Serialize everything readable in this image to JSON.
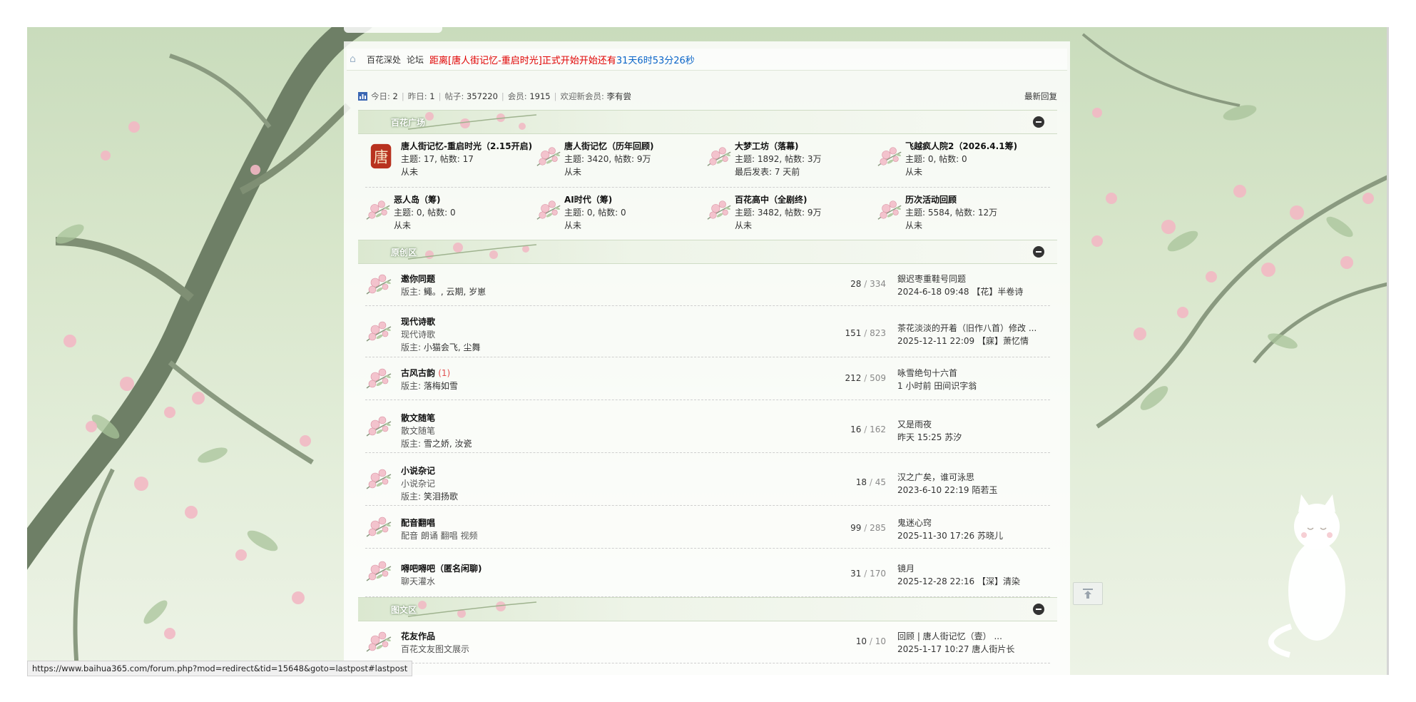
{
  "breadcrumb": {
    "crumbs": [
      "百花深处",
      "论坛"
    ],
    "notice_red_prefix": "距离[唐人街记忆-重启时光]正式开始开始还有",
    "countdown": "31天6时53分26秒"
  },
  "stats": {
    "today_label": "今日:",
    "today_value": "2",
    "yesterday_label": "昨日:",
    "yesterday_value": "1",
    "posts_label": "帖子:",
    "posts_value": "357220",
    "members_label": "会员:",
    "members_value": "1915",
    "welcome_label": "欢迎新会员:",
    "newest_member": "李有尝",
    "latest_replies": "最新回复"
  },
  "sections": {
    "plaza": {
      "title": "百花广场",
      "forums": [
        {
          "name": "唐人街记忆-重启时光（2.15开启)",
          "stats": "主题: 17, 帖数: 17",
          "last": "从未",
          "icon": "tang-seal-icon"
        },
        {
          "name": "唐人街记忆（历年回顾)",
          "stats": "主题: 3420, 帖数: 9万",
          "last": "从未",
          "icon": "flower-icon"
        },
        {
          "name": "大梦工坊（落幕)",
          "stats": "主题: 1892, 帖数: 3万",
          "last": "最后发表: 7 天前",
          "icon": "flower-icon"
        },
        {
          "name": "飞越疯人院2（2026.4.1筹)",
          "stats": "主题: 0, 帖数: 0",
          "last": "从未",
          "icon": "flower-icon"
        },
        {
          "name": "恶人岛（筹)",
          "stats": "主题: 0, 帖数: 0",
          "last": "从未",
          "icon": "flower-icon"
        },
        {
          "name": "AI时代（筹)",
          "stats": "主题: 0, 帖数: 0",
          "last": "从未",
          "icon": "flower-icon"
        },
        {
          "name": "百花高中（全剧终)",
          "stats": "主题: 3482, 帖数: 9万",
          "last": "从未",
          "icon": "flower-icon"
        },
        {
          "name": "历次活动回顾",
          "stats": "主题: 5584, 帖数: 12万",
          "last": "从未",
          "icon": "flower-icon"
        }
      ]
    },
    "original": {
      "title": "原创区",
      "forums": [
        {
          "name": "邀你同题",
          "today": "",
          "desc": "",
          "mods_label": "版主:",
          "mods": "鱦。, 云期, 岁崽",
          "threads": "28",
          "posts": "334",
          "lp_title": "銀迟枣重鞋号同题",
          "lp_meta": "2024-6-18 09:48 【花】半卷诗"
        },
        {
          "name": "现代诗歌",
          "today": "",
          "desc": "现代诗歌",
          "mods_label": "版主:",
          "mods": "小猫会飞, 尘舞",
          "threads": "151",
          "posts": "823",
          "lp_title": "茶花淡淡的开着（旧作八首）修改 ...",
          "lp_meta": "2025-12-11 22:09 【寐】萧忆情"
        },
        {
          "name": "古风古韵",
          "today": "(1)",
          "desc": "",
          "mods_label": "版主:",
          "mods": "落梅如雪",
          "threads": "212",
          "posts": "509",
          "lp_title": "咏雪绝句十六首",
          "lp_meta": "1 小时前 田间识字翁"
        },
        {
          "name": "散文随笔",
          "today": "",
          "desc": "散文随笔",
          "mods_label": "版主:",
          "mods": "雪之娇, 汝瓷",
          "threads": "16",
          "posts": "162",
          "lp_title": "又是雨夜",
          "lp_meta": "昨天 15:25 苏汐"
        },
        {
          "name": "小说杂记",
          "today": "",
          "desc": "小说杂记",
          "mods_label": "版主:",
          "mods": "笑泪扬歌",
          "threads": "18",
          "posts": "45",
          "lp_title": "汉之广矣，谁可泳思",
          "lp_meta": "2023-6-10 22:19 陌若玉"
        },
        {
          "name": "配音翻唱",
          "today": "",
          "desc": "配音 朗诵 翻唱 视频",
          "mods_label": "",
          "mods": "",
          "threads": "99",
          "posts": "285",
          "lp_title": "鬼迷心窍",
          "lp_meta": "2025-11-30 17:26 苏晓儿"
        },
        {
          "name": "嘚吧嘚吧（匿名闲聊)",
          "today": "",
          "desc": "聊天灌水",
          "mods_label": "",
          "mods": "",
          "threads": "31",
          "posts": "170",
          "lp_title": "镜月",
          "lp_meta": "2025-12-28 22:16 【深】清染"
        }
      ]
    },
    "graphic": {
      "title": "图文区",
      "forums": [
        {
          "name": "花友作品",
          "today": "",
          "desc": "百花文友图文展示",
          "mods_label": "",
          "mods": "",
          "threads": "10",
          "posts": "10",
          "lp_title": "回顾 | 唐人街记忆（壹） ...",
          "lp_meta": "2025-1-17 10:27 唐人街片长"
        }
      ]
    }
  },
  "status_url": "https://www.baihua365.com/forum.php?mod=redirect&tid=15648&goto=lastpost#lastpost",
  "colors": {
    "notice_red": "#e00000",
    "notice_blue": "#0a64c8",
    "blossom": "#f2b8c4",
    "leaf": "#a9c39a"
  }
}
